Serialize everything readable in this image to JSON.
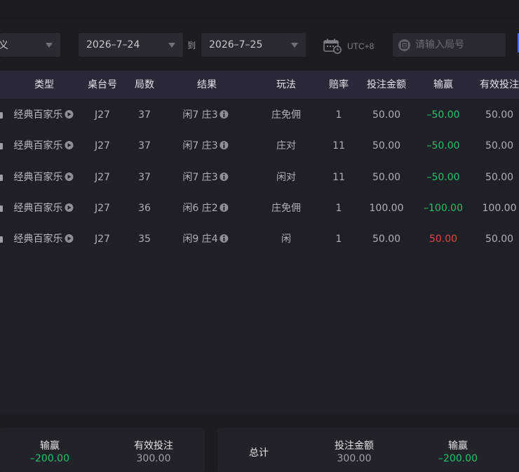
{
  "filters": {
    "type_value": "义",
    "start_date": "2026–7–24",
    "to_label": "到",
    "end_date": "2026–7–25",
    "timezone": "UTC+8",
    "search_placeholder": "请输入局号"
  },
  "table": {
    "headers": {
      "type": "类型",
      "table_no": "桌台号",
      "round": "局数",
      "result": "结果",
      "play": "玩法",
      "odds": "赔率",
      "bet": "投注金额",
      "winloss": "输赢",
      "valid_bet": "有效投注"
    },
    "rows": [
      {
        "game": "经典百家乐",
        "table_no": "J27",
        "round": "37",
        "result": "闲7 庄3",
        "play": "庄免佣",
        "odds": "1",
        "bet": "50.00",
        "winloss": "–50.00",
        "valid_bet": "50.00"
      },
      {
        "game": "经典百家乐",
        "table_no": "J27",
        "round": "37",
        "result": "闲7 庄3",
        "play": "庄对",
        "odds": "11",
        "bet": "50.00",
        "winloss": "–50.00",
        "valid_bet": "50.00"
      },
      {
        "game": "经典百家乐",
        "table_no": "J27",
        "round": "37",
        "result": "闲7 庄3",
        "play": "闲对",
        "odds": "11",
        "bet": "50.00",
        "winloss": "–50.00",
        "valid_bet": "50.00"
      },
      {
        "game": "经典百家乐",
        "table_no": "J27",
        "round": "36",
        "result": "闲6 庄2",
        "play": "庄免佣",
        "odds": "1",
        "bet": "100.00",
        "winloss": "–100.00",
        "valid_bet": "100.00"
      },
      {
        "game": "经典百家乐",
        "table_no": "J27",
        "round": "35",
        "result": "闲9 庄4",
        "play": "闲",
        "odds": "1",
        "bet": "50.00",
        "winloss": "50.00",
        "valid_bet": "50.00"
      }
    ]
  },
  "summary_page": {
    "winloss_label": "输赢",
    "winloss_value": "–200.00",
    "valid_label": "有效投注",
    "valid_value": "300.00"
  },
  "summary_total": {
    "label": "总计",
    "bet_label": "投注金额",
    "bet_value": "300.00",
    "winloss_label": "输赢",
    "winloss_value": "–200.00"
  },
  "colors": {
    "loss": "#25c26a",
    "win": "#e0474a",
    "accent": "#4a6be0"
  }
}
